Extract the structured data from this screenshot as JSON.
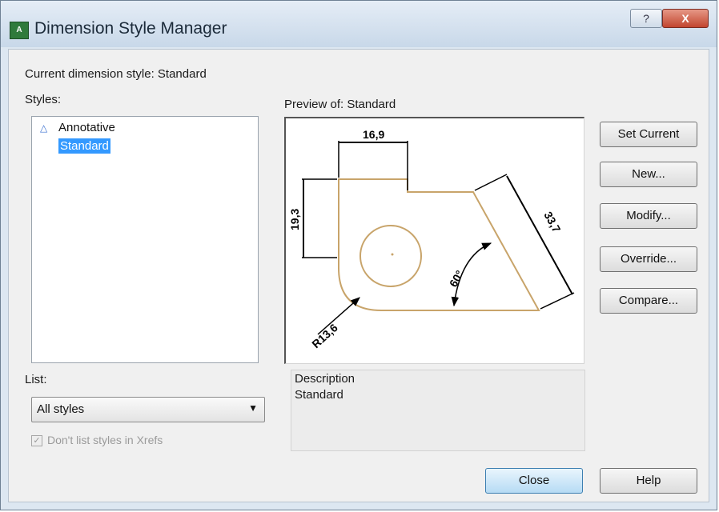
{
  "window": {
    "title": "Dimension Style Manager",
    "help_glyph": "?",
    "close_glyph": "X"
  },
  "current_style": "Current dimension style: Standard",
  "styles_label": "Styles:",
  "styles": [
    {
      "name": "Annotative",
      "icon": "annotative-triangle-icon",
      "selected": false
    },
    {
      "name": "Standard",
      "selected": true
    }
  ],
  "list_label": "List:",
  "list_value": "All styles",
  "xref_checkbox": {
    "label": "Don't list styles in Xrefs",
    "checked": true,
    "enabled": false
  },
  "preview_label": "Preview of: Standard",
  "preview_dims": {
    "linear_top": "16,9",
    "linear_left": "19,3",
    "aligned": "33,7",
    "angle": "60°",
    "radius": "R13,6"
  },
  "description": {
    "label": "Description",
    "value": "Standard"
  },
  "buttons": {
    "set_current": "Set Current",
    "new": "New...",
    "modify": "Modify...",
    "override": "Override...",
    "compare": "Compare...",
    "close": "Close",
    "help": "Help"
  },
  "colors": {
    "selection": "#3399ff",
    "geometry": "#c8a46a",
    "dimension": "#000000"
  }
}
